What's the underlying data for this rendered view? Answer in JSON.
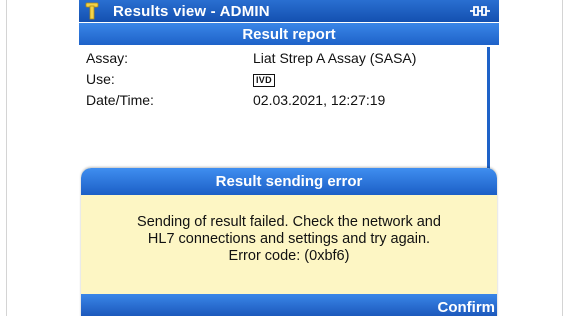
{
  "titlebar": {
    "title": "Results view - ADMIN",
    "app_icon": "tool-icon",
    "status_icon": "network-connector-icon"
  },
  "report": {
    "header": "Result report",
    "rows": [
      {
        "label": "Assay:",
        "value": "Liat Strep A Assay (SASA)"
      },
      {
        "label": "Use:",
        "value": "IVD"
      },
      {
        "label": "Date/Time:",
        "value": "02.03.2021, 12:27:19"
      }
    ]
  },
  "dialog": {
    "title": "Result sending error",
    "message_lines": [
      "Sending of result failed. Check the network and",
      "HL7 connections and settings and try again.",
      "Error code: (0xbf6)"
    ],
    "confirm_label": "Confirm"
  },
  "colors": {
    "titlebar": "#1450b0",
    "header": "#1e62c8",
    "dialog_bg": "#fdf6c4",
    "app_icon": "#f2d34a"
  }
}
